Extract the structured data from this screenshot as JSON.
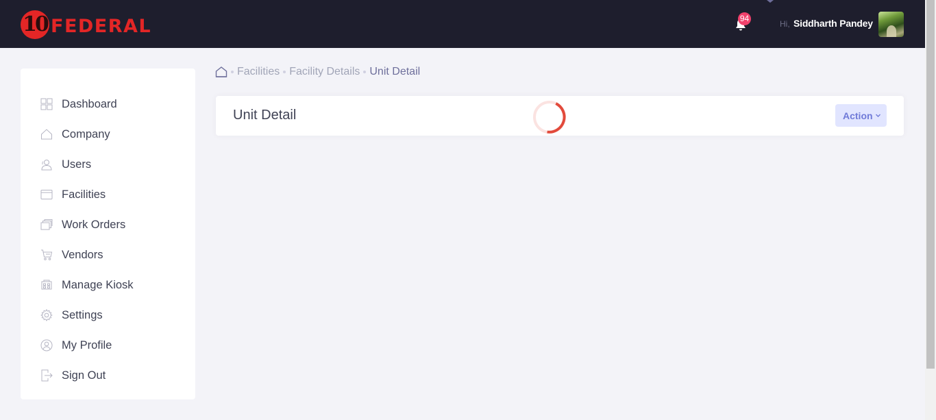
{
  "header": {
    "logo_number": "10",
    "logo_word": "FEDERAL",
    "notification_count": "94",
    "greeting": "Hi,",
    "user_name": "Siddharth Pandey"
  },
  "sidebar": {
    "items": [
      {
        "label": "Dashboard",
        "icon": "dashboard-icon"
      },
      {
        "label": "Company",
        "icon": "home-icon"
      },
      {
        "label": "Users",
        "icon": "users-icon"
      },
      {
        "label": "Facilities",
        "icon": "facilities-icon"
      },
      {
        "label": "Work Orders",
        "icon": "work-orders-icon"
      },
      {
        "label": "Vendors",
        "icon": "cart-icon"
      },
      {
        "label": "Manage Kiosk",
        "icon": "kiosk-icon"
      },
      {
        "label": "Settings",
        "icon": "gear-icon"
      },
      {
        "label": "My Profile",
        "icon": "profile-icon"
      },
      {
        "label": "Sign Out",
        "icon": "sign-out-icon"
      }
    ]
  },
  "breadcrumb": {
    "items": [
      "Facilities",
      "Facility Details"
    ],
    "current": "Unit Detail"
  },
  "card": {
    "title": "Unit Detail",
    "action_label": "Action"
  },
  "colors": {
    "header_bg": "#1e1e2d",
    "brand_red": "#e32626",
    "badge": "#f1416c",
    "page_bg": "#f3f3f8",
    "action_bg": "#e1e5ff",
    "action_text": "#6f7ad8"
  }
}
